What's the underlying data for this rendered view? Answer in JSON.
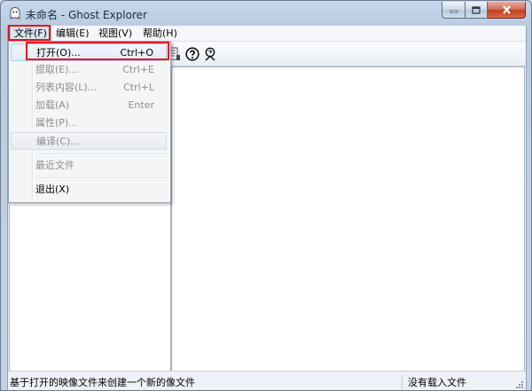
{
  "window": {
    "title": "未命名 - Ghost Explorer"
  },
  "menubar": {
    "items": [
      {
        "label": "文件(F)",
        "name": "menu-file"
      },
      {
        "label": "编辑(E)",
        "name": "menu-edit"
      },
      {
        "label": "视图(V)",
        "name": "menu-view"
      },
      {
        "label": "帮助(H)",
        "name": "menu-help"
      }
    ]
  },
  "file_menu": {
    "items": [
      {
        "label": "打开(O)...",
        "shortcut": "Ctrl+O",
        "enabled": true
      },
      {
        "label": "提取(E)...",
        "shortcut": "Ctrl+E",
        "enabled": false
      },
      {
        "label": "列表内容(L)...",
        "shortcut": "Ctrl+L",
        "enabled": false
      },
      {
        "label": "加载(A)",
        "shortcut": "Enter",
        "enabled": false
      },
      {
        "label": "属性(P)...",
        "shortcut": "",
        "enabled": false
      },
      {
        "label": "编译(C)...",
        "shortcut": "",
        "enabled": false
      },
      {
        "label": "最近文件",
        "shortcut": "",
        "enabled": false
      },
      {
        "label": "退出(X)",
        "shortcut": "",
        "enabled": true
      }
    ]
  },
  "toolbar": {
    "icons": [
      "properties-icon",
      "help-icon",
      "context-help-icon"
    ]
  },
  "statusbar": {
    "hint": "基于打开的映像文件来创建一个新的像文件",
    "state": "没有载入文件"
  },
  "colors": {
    "highlight_box": "#e4141d"
  }
}
